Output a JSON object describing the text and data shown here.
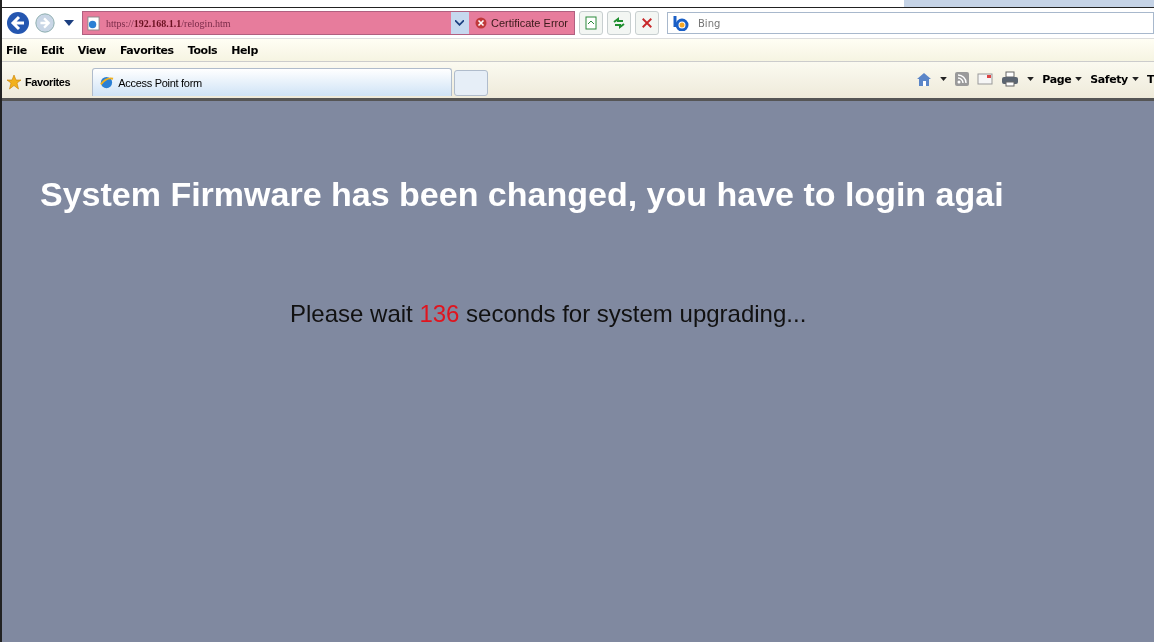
{
  "address_bar": {
    "scheme": "https://",
    "host": "192.168.1.1",
    "path": "/relogin.htm"
  },
  "certificate_error": "Certificate Error",
  "search": {
    "placeholder": "Bing"
  },
  "menu": [
    "File",
    "Edit",
    "View",
    "Favorites",
    "Tools",
    "Help"
  ],
  "favorites": "Favorites",
  "tabs": [
    {
      "label": "Access Point form",
      "selected": true
    }
  ],
  "command_bar": [
    "Page",
    "Safety",
    "T"
  ],
  "page": {
    "heading": "System Firmware has been changed, you have to login agai",
    "message_before": "Please wait",
    "countdown": "136",
    "message_after": "seconds for system upgrading..."
  }
}
